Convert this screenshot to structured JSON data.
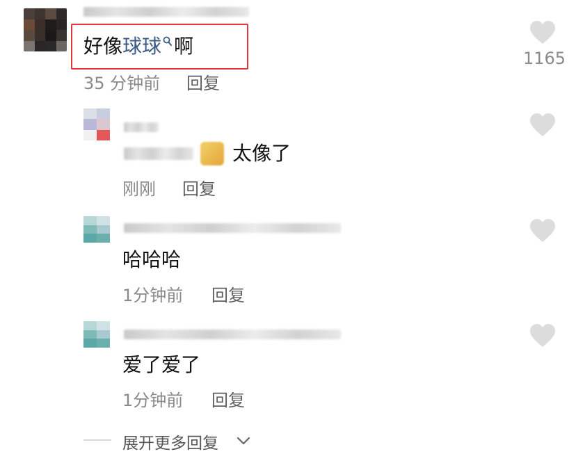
{
  "main_comment": {
    "text_before": "好像",
    "keyword": "球球",
    "text_after": "啊",
    "time": "35 分钟前",
    "reply_label": "回复",
    "likes": "1165"
  },
  "replies": [
    {
      "text": "太像了",
      "time": "刚刚",
      "reply_label": "回复"
    },
    {
      "text": "哈哈哈",
      "time": "1分钟前",
      "reply_label": "回复"
    },
    {
      "text": "爱了爱了",
      "time": "1分钟前",
      "reply_label": "回复"
    }
  ],
  "expand_label": "展开更多回复",
  "colors": {
    "highlight_border": "#e4393c",
    "keyword": "#3b5b86",
    "meta": "#8a8a8a",
    "heart": "#dcdcdc"
  },
  "icons": {
    "heart": "heart-icon",
    "search": "search-icon",
    "chevron": "chevron-down-icon"
  }
}
